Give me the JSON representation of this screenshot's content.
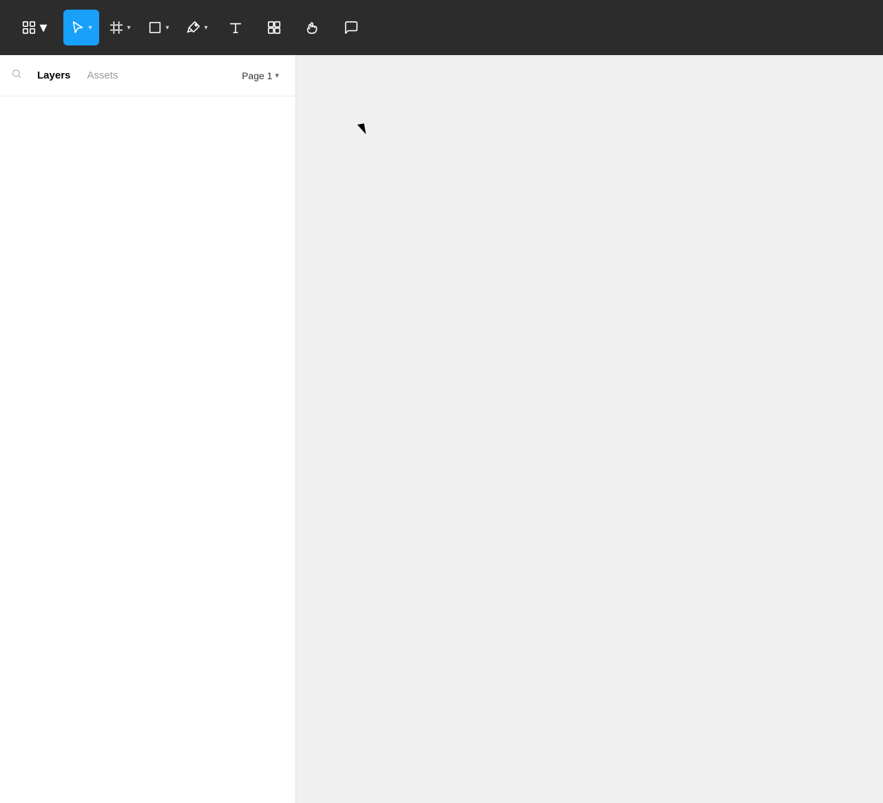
{
  "toolbar": {
    "logo_label": "⊞",
    "select_label": "Select",
    "frame_label": "Frame",
    "shape_label": "Shape",
    "pen_label": "Pen",
    "text_label": "Text",
    "component_label": "Component",
    "hand_label": "Hand",
    "comment_label": "Comment",
    "chevron": "▾",
    "accent_color": "#18a0fb",
    "bg_color": "#2c2c2c"
  },
  "panel": {
    "search_placeholder": "Search",
    "layers_tab": "Layers",
    "assets_tab": "Assets",
    "page_label": "Page 1"
  },
  "canvas": {
    "bg_color": "#f0f0f0"
  }
}
